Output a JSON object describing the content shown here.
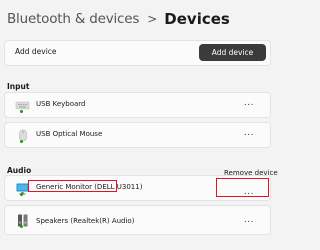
{
  "header": {
    "parent": "Bluetooth & devices",
    "separator": ">",
    "current": "Devices"
  },
  "add_device": {
    "label": "Add device",
    "button_label": "Add device"
  },
  "sections": {
    "input": {
      "label": "Input"
    },
    "audio": {
      "label": "Audio"
    }
  },
  "devices": [
    {
      "name": "USB Keyboard",
      "icon": "keyboard-icon",
      "status": "connected",
      "more": "..."
    },
    {
      "name": "USB Optical Mouse",
      "icon": "mouse-icon",
      "status": "connected",
      "more": "..."
    },
    {
      "name": "Generic Monitor (DELL U3011)",
      "icon": "monitor-icon",
      "status": "connected",
      "more": "..."
    },
    {
      "name": "Speakers (Realtek(R) Audio)",
      "icon": "speaker-icon",
      "status": "connected",
      "more": "..."
    }
  ],
  "context_menu": {
    "remove_label": "Remove device"
  },
  "colors": {
    "accent_dark": "#3b3b3b",
    "status_green": "#13a10e",
    "highlight_red": "#e81123",
    "monitor_blue": "#1a8fcf"
  }
}
